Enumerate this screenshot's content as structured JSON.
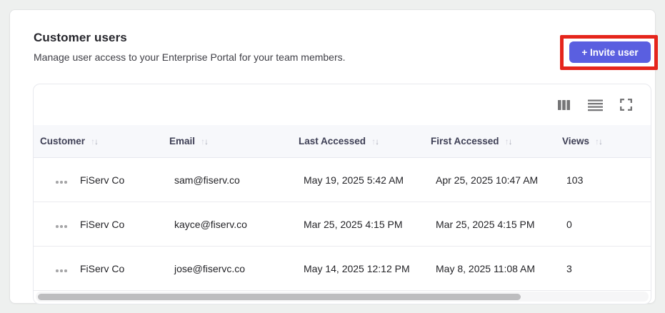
{
  "header": {
    "title": "Customer users",
    "subtitle": "Manage user access to your Enterprise Portal for your team members.",
    "invite_button_label": "+ Invite user"
  },
  "annotation": {
    "highlight_color": "#e5251c"
  },
  "toolbar": {
    "icons": [
      "columns-icon",
      "density-icon",
      "fullscreen-icon"
    ]
  },
  "icons": {
    "sort_up": "↑",
    "sort_down": "↓",
    "row_menu": "•••"
  },
  "table": {
    "columns": [
      {
        "label": "Customer",
        "sortable": true
      },
      {
        "label": "Email",
        "sortable": true
      },
      {
        "label": "Last Accessed",
        "sortable": true
      },
      {
        "label": "First Accessed",
        "sortable": true
      },
      {
        "label": "Views",
        "sortable": true
      }
    ],
    "rows": [
      {
        "customer": "FiServ Co",
        "email": "sam@fiserv.co",
        "last_accessed": "May 19, 2025 5:42 AM",
        "first_accessed": "Apr 25, 2025 10:47 AM",
        "views": "103"
      },
      {
        "customer": "FiServ Co",
        "email": "kayce@fiserv.co",
        "last_accessed": "Mar 25, 2025 4:15 PM",
        "first_accessed": "Mar 25, 2025 4:15 PM",
        "views": "0"
      },
      {
        "customer": "FiServ Co",
        "email": "jose@fiservc.co",
        "last_accessed": "May 14, 2025 12:12 PM",
        "first_accessed": "May 8, 2025 11:08 AM",
        "views": "3"
      }
    ]
  },
  "colors": {
    "accent": "#5a5fe0",
    "annotation": "#e5251c",
    "header_bg": "#f7f8fb",
    "page_bg": "#eef0ef"
  }
}
